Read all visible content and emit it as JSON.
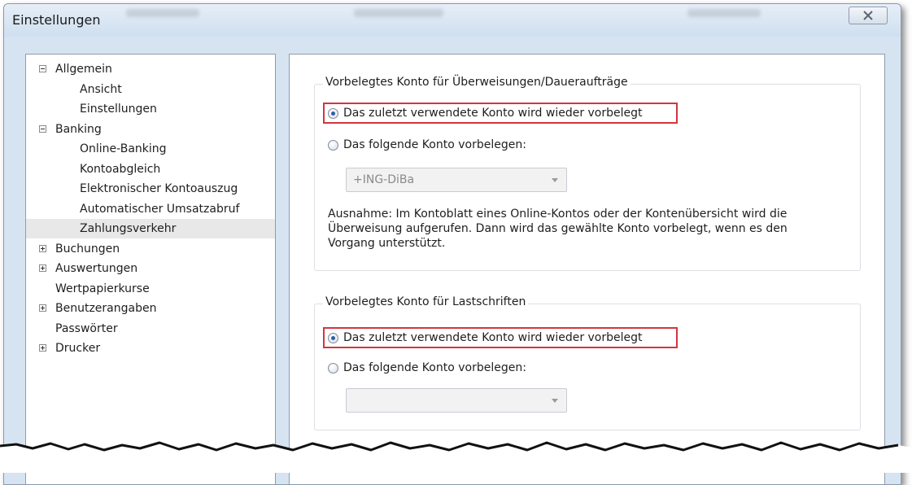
{
  "window": {
    "title": "Einstellungen"
  },
  "tree": {
    "items": [
      {
        "label": "Allgemein",
        "level": 0,
        "expander": "minus"
      },
      {
        "label": "Ansicht",
        "level": 1
      },
      {
        "label": "Einstellungen",
        "level": 1
      },
      {
        "label": "Banking",
        "level": 0,
        "expander": "minus"
      },
      {
        "label": "Online-Banking",
        "level": 1
      },
      {
        "label": "Kontoabgleich",
        "level": 1
      },
      {
        "label": "Elektronischer Kontoauszug",
        "level": 1
      },
      {
        "label": "Automatischer Umsatzabruf",
        "level": 1
      },
      {
        "label": "Zahlungsverkehr",
        "level": 1,
        "selected": true
      },
      {
        "label": "Buchungen",
        "level": 0,
        "expander": "plus"
      },
      {
        "label": "Auswertungen",
        "level": 0,
        "expander": "plus"
      },
      {
        "label": "Wertpapierkurse",
        "level": 0
      },
      {
        "label": "Benutzerangaben",
        "level": 0,
        "expander": "plus"
      },
      {
        "label": "Passwörter",
        "level": 0
      },
      {
        "label": "Drucker",
        "level": 0,
        "expander": "plus"
      }
    ]
  },
  "transfers": {
    "legend": "Vorbelegtes Konto für Überweisungen/Daueraufträge",
    "option_last_used": "Das zuletzt verwendete Konto wird wieder vorbelegt",
    "option_fixed": "Das folgende Konto vorbelegen:",
    "selected_option": "last_used",
    "account_value": "+ING-DiBa",
    "note": "Ausnahme: Im Kontoblatt eines Online-Kontos oder der Kontenübersicht wird die Überweisung aufgerufen. Dann wird das gewählte Konto vorbelegt, wenn es den Vorgang unterstützt."
  },
  "direct_debits": {
    "legend": "Vorbelegtes Konto für Lastschriften",
    "option_last_used": "Das zuletzt verwendete Konto wird wieder vorbelegt",
    "option_fixed": "Das folgende Konto vorbelegen:",
    "selected_option": "last_used",
    "account_value": ""
  },
  "colors": {
    "highlight_border": "#d3363f",
    "radio_dot": "#2a5fa8",
    "window_frame": "#d6e4f2"
  }
}
